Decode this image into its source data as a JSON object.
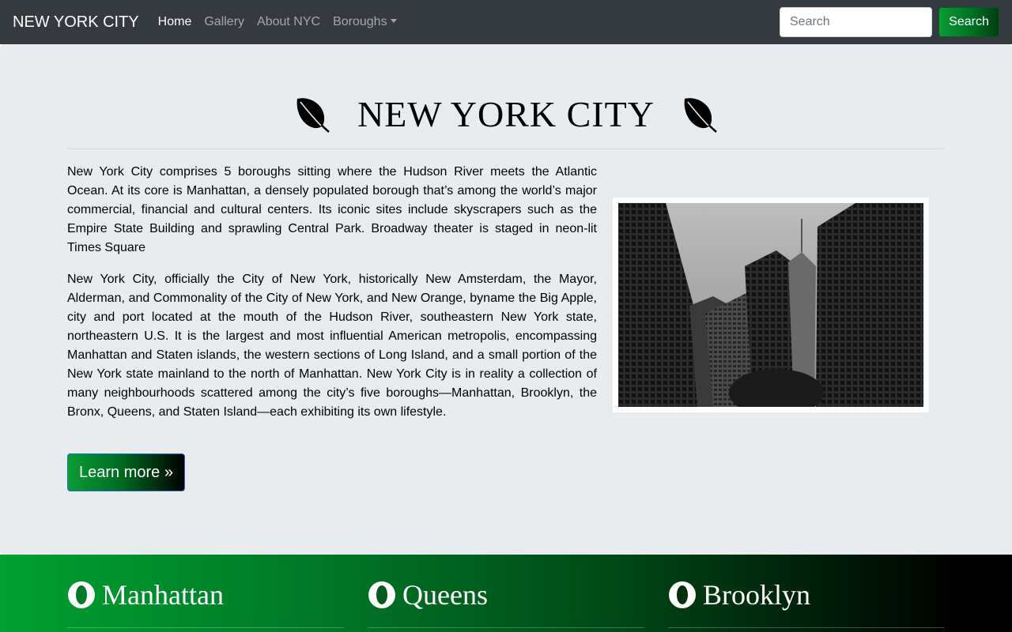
{
  "navbar": {
    "brand": "NEW YORK CITY",
    "links": [
      {
        "label": "Home",
        "active": true
      },
      {
        "label": "Gallery",
        "active": false
      },
      {
        "label": "About NYC",
        "active": false
      },
      {
        "label": "Boroughs",
        "active": false,
        "dropdown": true
      }
    ],
    "search": {
      "placeholder": "Search",
      "value": "",
      "button_label": "Search"
    }
  },
  "hero": {
    "title": "NEW YORK CITY",
    "title_icon": "leaf-icon",
    "paragraphs": [
      "New York City comprises 5 boroughs sitting where the Hudson River meets the Atlantic Ocean. At its core is Manhattan, a densely populated borough that’s among the world’s major commercial, financial and cultural centers. Its iconic sites include skyscrapers such as the Empire State Building and sprawling Central Park. Broadway theater is staged in neon-lit Times Square",
      "New York City, officially the City of New York, historically New Amsterdam, the Mayor, Alderman, and Commonality of the City of New York, and New Orange, byname the Big Apple, city and port located at the mouth of the Hudson River, southeastern New York state, northeastern U.S. It is the largest and most influential American metropolis, encompassing Manhattan and Staten islands, the western sections of Long Island, and a small portion of the New York state mainland to the north of Manhattan. New York City is in reality a collection of many neighbourhoods scattered among the city’s five boroughs—Manhattan, Brooklyn, the Bronx, Queens, and Staten Island—each exhibiting its own lifestyle."
    ],
    "image_subject": "black and white skyscrapers photo",
    "learn_more_label": "Learn more »"
  },
  "boroughs": [
    {
      "name": "Manhattan",
      "icon": "opera-ring-icon"
    },
    {
      "name": "Queens",
      "icon": "opera-ring-icon"
    },
    {
      "name": "Brooklyn",
      "icon": "opera-ring-icon"
    }
  ],
  "colors": {
    "navbar_bg": "#343a40",
    "jumbotron_bg": "#e9ecef",
    "accent_green": "#0a9c36"
  }
}
